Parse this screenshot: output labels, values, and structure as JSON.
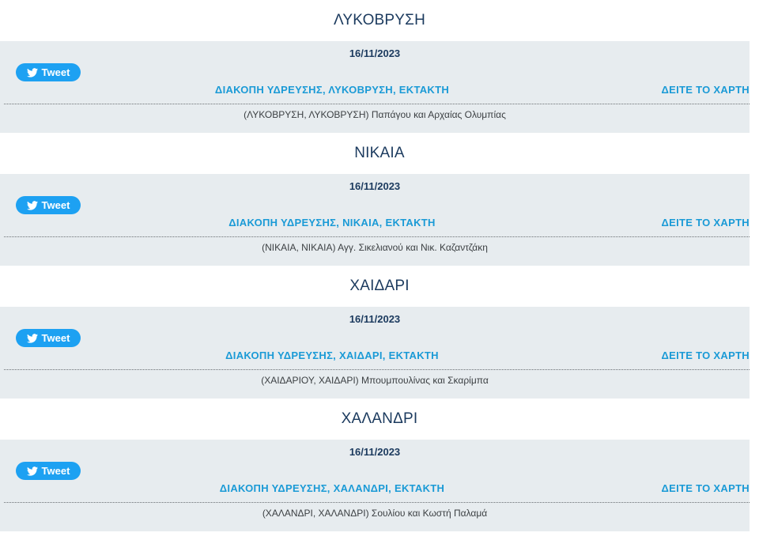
{
  "tweet_label": "Tweet",
  "map_label": "ΔΕΙΤΕ ΤΟ ΧΑΡΤΗ",
  "colors": {
    "title": "#1b3a5e",
    "accent": "#1a9ad6",
    "twitter": "#1da1f2",
    "card_bg": "#e7ecef"
  },
  "sections": [
    {
      "area": "ΛΥΚΟΒΡΥΣΗ",
      "date": "16/11/2023",
      "headline": "ΔΙΑΚΟΠΗ ΥΔΡΕΥΣΗΣ, ΛΥΚΟΒΡΥΣΗ, ΕΚΤΑΚΤΗ",
      "address": "(ΛΥΚΟΒΡΥΣΗ, ΛΥΚΟΒΡΥΣΗ) Παπάγου και Αρχαίας Ολυμπίας"
    },
    {
      "area": "ΝΙΚΑΙΑ",
      "date": "16/11/2023",
      "headline": "ΔΙΑΚΟΠΗ ΥΔΡΕΥΣΗΣ, ΝΙΚΑΙΑ, ΕΚΤΑΚΤΗ",
      "address": "(ΝΙΚΑΙΑ, ΝΙΚΑΙΑ) Αγγ. Σικελιανού και Νικ. Καζαντζάκη"
    },
    {
      "area": "ΧΑΙΔΑΡΙ",
      "date": "16/11/2023",
      "headline": "ΔΙΑΚΟΠΗ ΥΔΡΕΥΣΗΣ, ΧΑΙΔΑΡΙ, ΕΚΤΑΚΤΗ",
      "address": "(ΧΑΙΔΑΡΙΟΥ, ΧΑΙΔΑΡΙ) Μπουμπουλίνας και Σκαρίμπα"
    },
    {
      "area": "ΧΑΛΑΝΔΡΙ",
      "date": "16/11/2023",
      "headline": "ΔΙΑΚΟΠΗ ΥΔΡΕΥΣΗΣ, ΧΑΛΑΝΔΡΙ, ΕΚΤΑΚΤΗ",
      "address": "(ΧΑΛΑΝΔΡΙ, ΧΑΛΑΝΔΡΙ) Σουλίου και Κωστή Παλαμά"
    }
  ]
}
